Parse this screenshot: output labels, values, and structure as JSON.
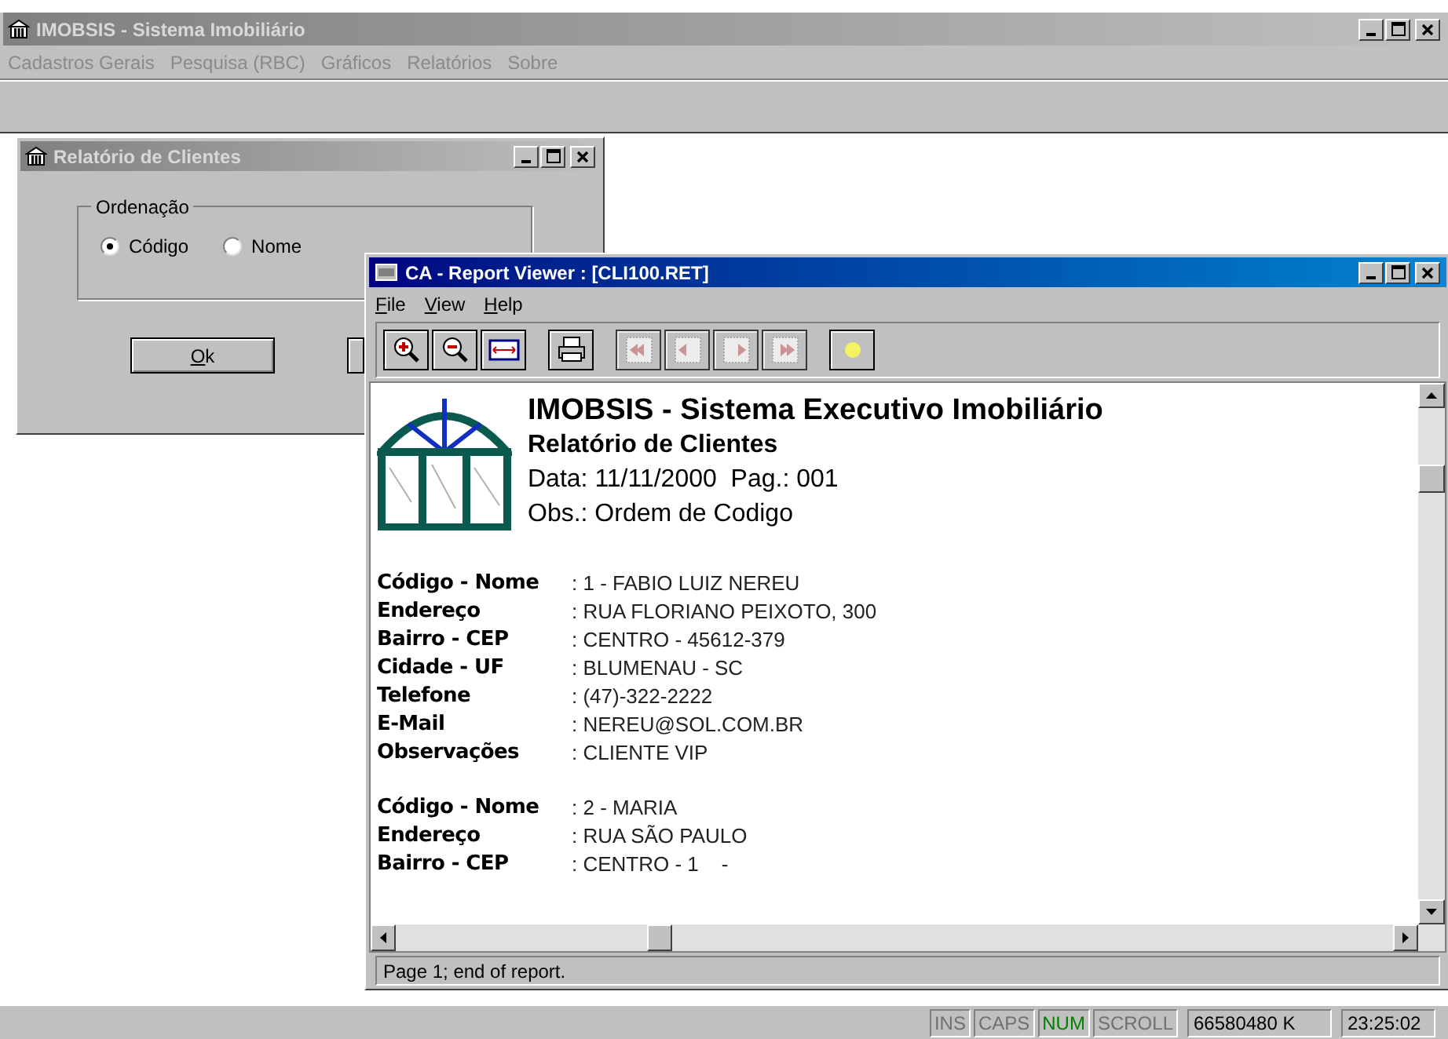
{
  "app": {
    "title": "IMOBSIS - Sistema Imobiliário",
    "menu": [
      "Cadastros Gerais",
      "Pesquisa (RBC)",
      "Gráficos",
      "Relatórios",
      "Sobre"
    ]
  },
  "dialog": {
    "title": "Relatório de Clientes",
    "group_label": "Ordenação",
    "options": [
      {
        "label": "Código",
        "selected": true
      },
      {
        "label": "Nome",
        "selected": false
      }
    ],
    "buttons": [
      {
        "label": "Ok"
      }
    ]
  },
  "viewer": {
    "title": "CA - Report Viewer : [CLI100.RET]",
    "menu": [
      {
        "label": "File"
      },
      {
        "label": "View"
      },
      {
        "label": "Help"
      }
    ],
    "toolbar": [
      {
        "kind": "zoom-in",
        "disabled": false
      },
      {
        "kind": "zoom-out",
        "disabled": false
      },
      {
        "kind": "fit",
        "disabled": false
      },
      {
        "kind": "print",
        "disabled": false
      },
      {
        "kind": "first",
        "disabled": true
      },
      {
        "kind": "prev",
        "disabled": true
      },
      {
        "kind": "next",
        "disabled": true
      },
      {
        "kind": "last",
        "disabled": true
      },
      {
        "kind": "light",
        "disabled": false
      }
    ],
    "report": {
      "heading": "IMOBSIS - Sistema Executivo Imobiliário",
      "subtitle": "Relatório de Clientes",
      "date_line": "Data: 11/11/2000  Pag.: 001",
      "obs_line": "Obs.: Ordem de Codigo",
      "records": [
        [
          {
            "label": "Código - Nome",
            "value": ": 1 - FABIO LUIZ NEREU"
          },
          {
            "label": "Endereço",
            "value": ": RUA FLORIANO PEIXOTO, 300"
          },
          {
            "label": "Bairro - CEP",
            "value": ": CENTRO - 45612-379"
          },
          {
            "label": "Cidade - UF",
            "value": ": BLUMENAU - SC"
          },
          {
            "label": "Telefone",
            "value": ": (47)-322-2222"
          },
          {
            "label": "E-Mail",
            "value": ": NEREU@SOL.COM.BR"
          },
          {
            "label": "Observações",
            "value": ": CLIENTE VIP"
          }
        ],
        [
          {
            "label": "Código - Nome",
            "value": ": 2 - MARIA"
          },
          {
            "label": "Endereço",
            "value": ": RUA SÃO PAULO"
          },
          {
            "label": "Bairro - CEP",
            "value": ": CENTRO - 1    -"
          }
        ]
      ]
    },
    "status": "Page 1; end of report."
  },
  "status_bar": {
    "indicators": [
      {
        "label": "INS",
        "on": false
      },
      {
        "label": "CAPS",
        "on": false
      },
      {
        "label": "NUM",
        "on": true
      },
      {
        "label": "SCROLL",
        "on": false
      }
    ],
    "memory": "66580480 K",
    "time": "23:25:02"
  }
}
